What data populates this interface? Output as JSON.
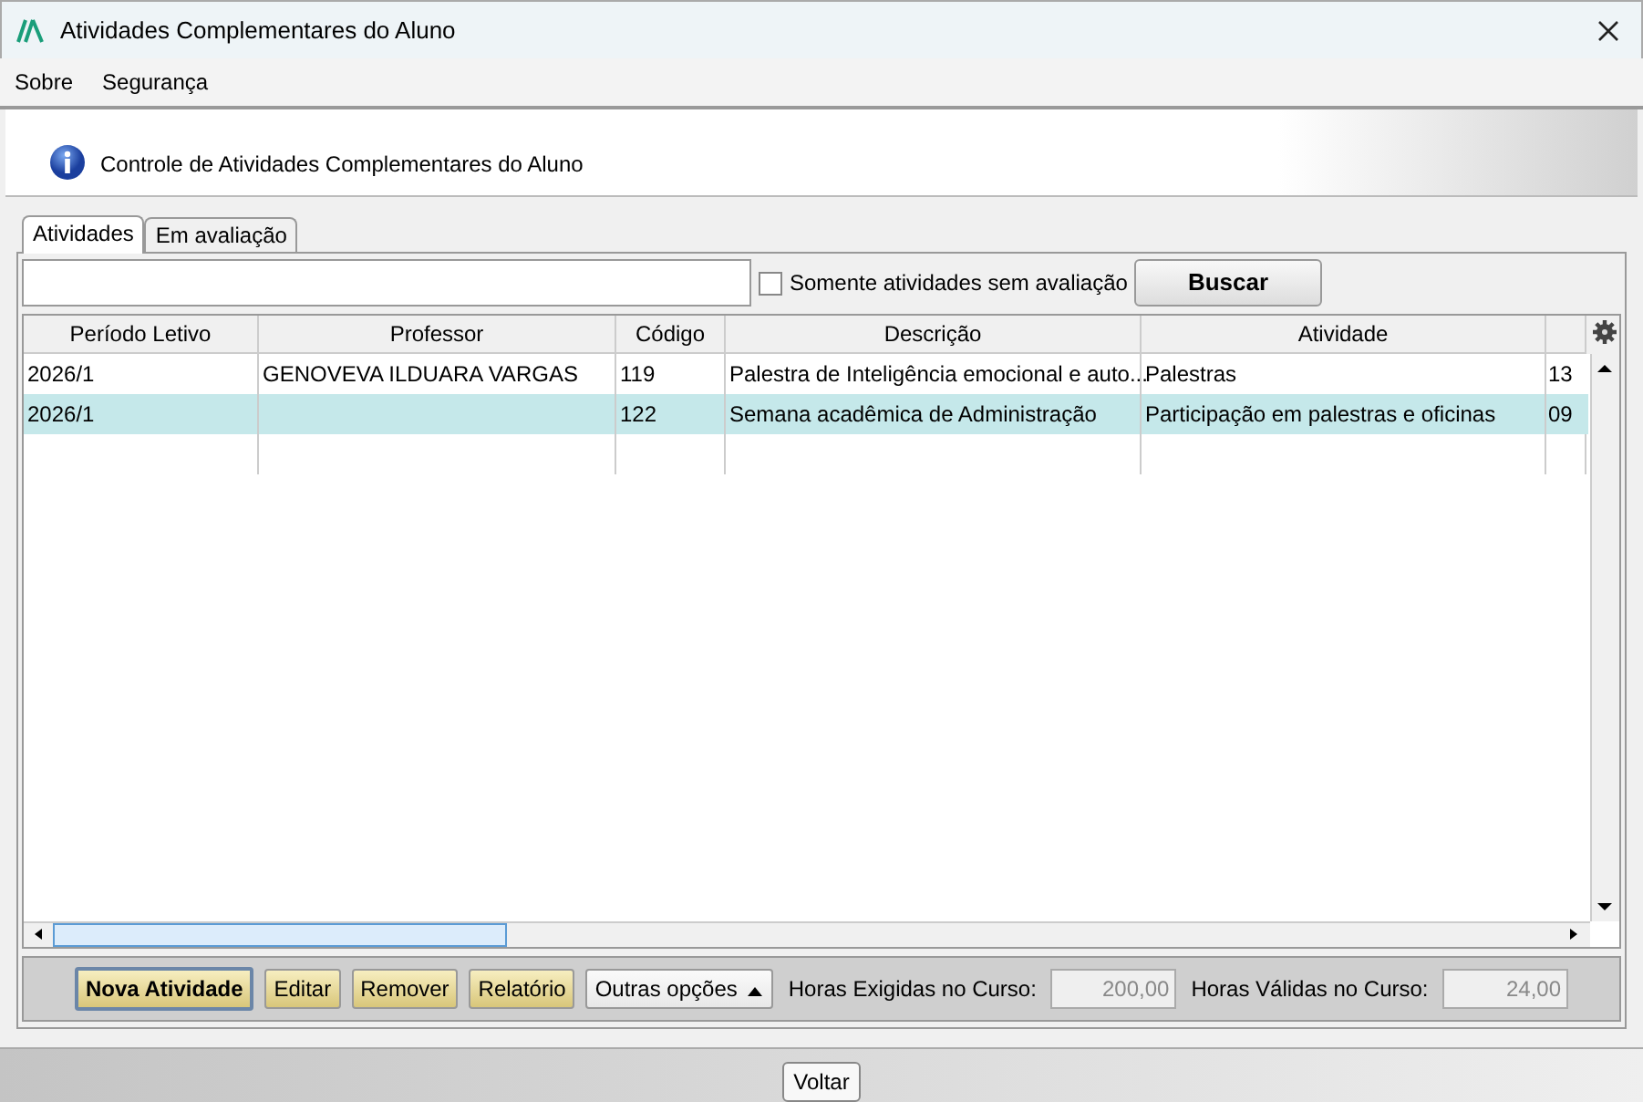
{
  "window": {
    "title": "Atividades Complementares do Aluno"
  },
  "menu": [
    "Sobre",
    "Segurança"
  ],
  "header": {
    "text": "Controle de Atividades Complementares do Aluno"
  },
  "tabs": [
    {
      "label": "Atividades",
      "selected": true
    },
    {
      "label": "Em avaliação",
      "selected": false
    }
  ],
  "search": {
    "checkbox_label": "Somente atividades sem avaliação",
    "checked": false,
    "button": "Buscar"
  },
  "table": {
    "columns": [
      "Período Letivo",
      "Professor",
      "Código",
      "Descrição",
      "Atividade"
    ],
    "rows": [
      {
        "cells": [
          "2026/1",
          "GENOVEVA ILDUARA VARGAS",
          "119",
          "Palestra de Inteligência emocional e auto...",
          "Palestras",
          "13"
        ],
        "selected": false
      },
      {
        "cells": [
          "2026/1",
          "",
          "122",
          "Semana acadêmica de Administração",
          "Participação em palestras e oficinas",
          "09"
        ],
        "selected": true
      }
    ]
  },
  "toolbar": {
    "buttons": [
      {
        "label": "Nova Atividade",
        "kind": "primary"
      },
      {
        "label": "Editar",
        "kind": "gold"
      },
      {
        "label": "Remover",
        "kind": "gold"
      },
      {
        "label": "Relatório",
        "kind": "gold"
      },
      {
        "label": "Outras opções",
        "kind": "dropdown"
      }
    ],
    "fields": [
      {
        "label": "Horas Exigidas no Curso:",
        "value": "200,00"
      },
      {
        "label": "Horas Válidas no Curso:",
        "value": "24,00"
      }
    ]
  },
  "footer": {
    "button": "Voltar"
  }
}
